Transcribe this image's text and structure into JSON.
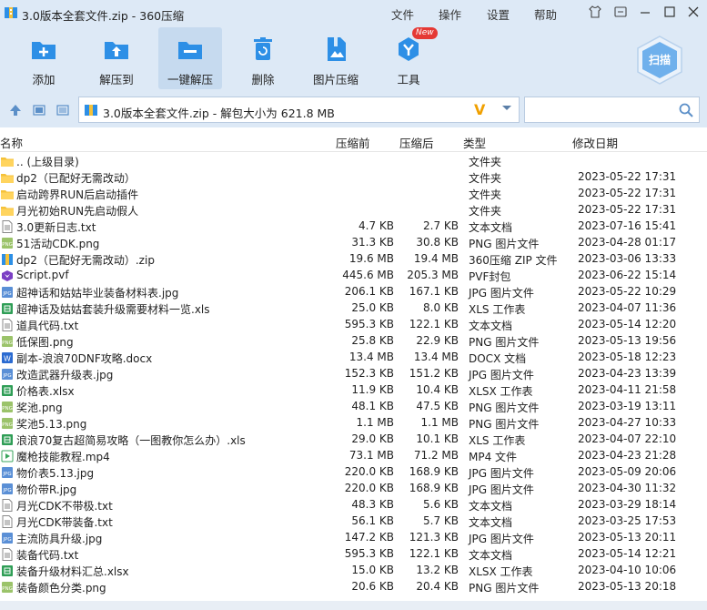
{
  "window": {
    "title": "3.0版本全套文件.zip - 360压缩",
    "menu": [
      "文件",
      "操作",
      "设置",
      "帮助"
    ]
  },
  "toolbar": {
    "tools": [
      {
        "label": "添加",
        "icon": "add-icon"
      },
      {
        "label": "解压到",
        "icon": "extract-to-icon"
      },
      {
        "label": "一键解压",
        "icon": "one-click-extract-icon"
      },
      {
        "label": "删除",
        "icon": "delete-icon"
      },
      {
        "label": "图片压缩",
        "icon": "image-compress-icon"
      },
      {
        "label": "工具",
        "icon": "tools-icon"
      }
    ],
    "new_badge": "New",
    "scan_label": "扫描"
  },
  "address": {
    "path": "3.0版本全套文件.zip - 解包大小为 621.8 MB",
    "search_placeholder": ""
  },
  "columns": {
    "name": "名称",
    "size": "压缩前",
    "packed": "压缩后",
    "type": "类型",
    "date": "修改日期"
  },
  "rows": [
    {
      "name": ".. (上级目录)",
      "size": "",
      "packed": "",
      "type": "文件夹",
      "date": "",
      "kind": "folder"
    },
    {
      "name": "dp2（已配好无需改动）",
      "size": "",
      "packed": "",
      "type": "文件夹",
      "date": "2023-05-22 17:31",
      "kind": "folder"
    },
    {
      "name": "启动跨界RUN后启动插件",
      "size": "",
      "packed": "",
      "type": "文件夹",
      "date": "2023-05-22 17:31",
      "kind": "folder"
    },
    {
      "name": "月光初始RUN先启动假人",
      "size": "",
      "packed": "",
      "type": "文件夹",
      "date": "2023-05-22 17:31",
      "kind": "folder"
    },
    {
      "name": "3.0更新日志.txt",
      "size": "4.7 KB",
      "packed": "2.7 KB",
      "type": "文本文档",
      "date": "2023-07-16 15:41",
      "kind": "txt"
    },
    {
      "name": "51活动CDK.png",
      "size": "31.3 KB",
      "packed": "30.8 KB",
      "type": "PNG 图片文件",
      "date": "2023-04-28 01:17",
      "kind": "png"
    },
    {
      "name": "dp2（已配好无需改动）.zip",
      "size": "19.6 MB",
      "packed": "19.4 MB",
      "type": "360压缩 ZIP 文件",
      "date": "2023-03-06 13:33",
      "kind": "zip"
    },
    {
      "name": "Script.pvf",
      "size": "445.6 MB",
      "packed": "205.3 MB",
      "type": "PVF封包",
      "date": "2023-06-22 15:14",
      "kind": "pvf"
    },
    {
      "name": "超神话和姑姑毕业装备材料表.jpg",
      "size": "206.1 KB",
      "packed": "167.1 KB",
      "type": "JPG 图片文件",
      "date": "2023-05-22 10:29",
      "kind": "jpg"
    },
    {
      "name": "超神话及姑姑套装升级需要材料一览.xls",
      "size": "25.0 KB",
      "packed": "8.0 KB",
      "type": "XLS 工作表",
      "date": "2023-04-07 11:36",
      "kind": "xls"
    },
    {
      "name": "道具代码.txt",
      "size": "595.3 KB",
      "packed": "122.1 KB",
      "type": "文本文档",
      "date": "2023-05-14 12:20",
      "kind": "txt"
    },
    {
      "name": "低保图.png",
      "size": "25.8 KB",
      "packed": "22.9 KB",
      "type": "PNG 图片文件",
      "date": "2023-05-13 19:56",
      "kind": "png"
    },
    {
      "name": "副本-浪浪70DNF攻略.docx",
      "size": "13.4 MB",
      "packed": "13.4 MB",
      "type": "DOCX 文档",
      "date": "2023-05-18 12:23",
      "kind": "docx"
    },
    {
      "name": "改造武器升级表.jpg",
      "size": "152.3 KB",
      "packed": "151.2 KB",
      "type": "JPG 图片文件",
      "date": "2023-04-23 13:39",
      "kind": "jpg"
    },
    {
      "name": "价格表.xlsx",
      "size": "11.9 KB",
      "packed": "10.4 KB",
      "type": "XLSX 工作表",
      "date": "2023-04-11 21:58",
      "kind": "xls"
    },
    {
      "name": "奖池.png",
      "size": "48.1 KB",
      "packed": "47.5 KB",
      "type": "PNG 图片文件",
      "date": "2023-03-19 13:11",
      "kind": "png"
    },
    {
      "name": "奖池5.13.png",
      "size": "1.1 MB",
      "packed": "1.1 MB",
      "type": "PNG 图片文件",
      "date": "2023-04-27 10:33",
      "kind": "png"
    },
    {
      "name": "浪浪70复古超简易攻略（一图教你怎么办）.xls",
      "size": "29.0 KB",
      "packed": "10.1 KB",
      "type": "XLS 工作表",
      "date": "2023-04-07 22:10",
      "kind": "xls"
    },
    {
      "name": "魔枪技能教程.mp4",
      "size": "73.1 MB",
      "packed": "71.2 MB",
      "type": "MP4 文件",
      "date": "2023-04-23 21:28",
      "kind": "mp4"
    },
    {
      "name": "物价表5.13.jpg",
      "size": "220.0 KB",
      "packed": "168.9 KB",
      "type": "JPG 图片文件",
      "date": "2023-05-09 20:06",
      "kind": "jpg"
    },
    {
      "name": "物价带R.jpg",
      "size": "220.0 KB",
      "packed": "168.9 KB",
      "type": "JPG 图片文件",
      "date": "2023-04-30 11:32",
      "kind": "jpg"
    },
    {
      "name": "月光CDK不带极.txt",
      "size": "48.3 KB",
      "packed": "5.6 KB",
      "type": "文本文档",
      "date": "2023-03-29 18:14",
      "kind": "txt"
    },
    {
      "name": "月光CDK带装备.txt",
      "size": "56.1 KB",
      "packed": "5.7 KB",
      "type": "文本文档",
      "date": "2023-03-25 17:53",
      "kind": "txt"
    },
    {
      "name": "主流防具升级.jpg",
      "size": "147.2 KB",
      "packed": "121.3 KB",
      "type": "JPG 图片文件",
      "date": "2023-05-13 20:11",
      "kind": "jpg"
    },
    {
      "name": "装备代码.txt",
      "size": "595.3 KB",
      "packed": "122.1 KB",
      "type": "文本文档",
      "date": "2023-05-14 12:21",
      "kind": "txt"
    },
    {
      "name": "装备升级材料汇总.xlsx",
      "size": "15.0 KB",
      "packed": "13.2 KB",
      "type": "XLSX 工作表",
      "date": "2023-04-10 10:06",
      "kind": "xls"
    },
    {
      "name": "装备颜色分类.png",
      "size": "20.6 KB",
      "packed": "20.4 KB",
      "type": "PNG 图片文件",
      "date": "2023-05-13 20:18",
      "kind": "png"
    }
  ],
  "colors": {
    "chrome": "#dde9f6",
    "accent": "#2d8fe6",
    "folder": "#f5c23a"
  }
}
